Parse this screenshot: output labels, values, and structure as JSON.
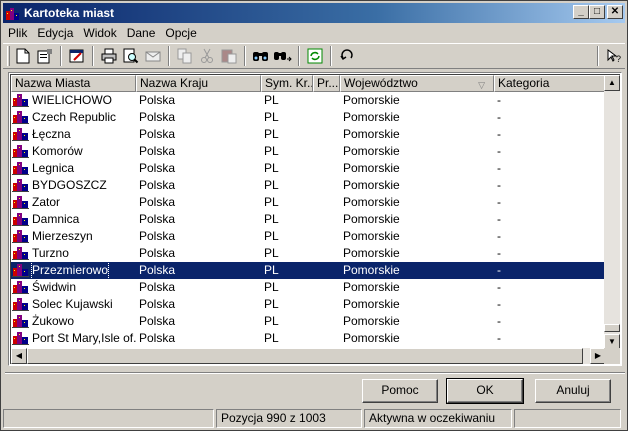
{
  "window": {
    "title": "Kartoteka miast"
  },
  "menu": [
    "Plik",
    "Edycja",
    "Widok",
    "Dane",
    "Opcje"
  ],
  "toolbar": {
    "tools": [
      "new-document-icon",
      "properties-icon",
      "edit-record-icon",
      "print-icon",
      "print-preview-icon",
      "email-icon",
      "copy-icon",
      "cut-icon",
      "paste-icon",
      "find-icon",
      "find-next-icon",
      "refresh-icon",
      "undo-icon",
      "help-pointer-icon"
    ]
  },
  "table": {
    "columns": [
      "Nazwa Miasta",
      "Nazwa Kraju",
      "Sym. Kr...",
      "Pr...",
      "Województwo",
      "Kategoria"
    ],
    "rows": [
      [
        "WIELICHOWO",
        "Polska",
        "PL",
        "",
        "Pomorskie",
        "-"
      ],
      [
        "Czech Republic",
        "Polska",
        "PL",
        "",
        "Pomorskie",
        "-"
      ],
      [
        "Łęczna",
        "Polska",
        "PL",
        "",
        "Pomorskie",
        "-"
      ],
      [
        "Komorów",
        "Polska",
        "PL",
        "",
        "Pomorskie",
        "-"
      ],
      [
        "Legnica",
        "Polska",
        "PL",
        "",
        "Pomorskie",
        "-"
      ],
      [
        "BYDGOSZCZ",
        "Polska",
        "PL",
        "",
        "Pomorskie",
        "-"
      ],
      [
        "Zator",
        "Polska",
        "PL",
        "",
        "Pomorskie",
        "-"
      ],
      [
        "Damnica",
        "Polska",
        "PL",
        "",
        "Pomorskie",
        "-"
      ],
      [
        "Mierzeszyn",
        "Polska",
        "PL",
        "",
        "Pomorskie",
        "-"
      ],
      [
        "Turzno",
        "Polska",
        "PL",
        "",
        "Pomorskie",
        "-"
      ],
      [
        "Przezmierowo",
        "Polska",
        "PL",
        "",
        "Pomorskie",
        "-"
      ],
      [
        "Świdwin",
        "Polska",
        "PL",
        "",
        "Pomorskie",
        "-"
      ],
      [
        "Solec Kujawski",
        "Polska",
        "PL",
        "",
        "Pomorskie",
        "-"
      ],
      [
        "Żukowo",
        "Polska",
        "PL",
        "",
        "Pomorskie",
        "-"
      ],
      [
        "Port St Mary,Isle of...",
        "Polska",
        "PL",
        "",
        "Pomorskie",
        "-"
      ]
    ],
    "selected_row": 10
  },
  "buttons": {
    "help": "Pomoc",
    "ok": "OK",
    "cancel": "Anuluj"
  },
  "status": {
    "position": "Pozycja 990 z 1003",
    "state": "Aktywna w oczekiwaniu"
  }
}
